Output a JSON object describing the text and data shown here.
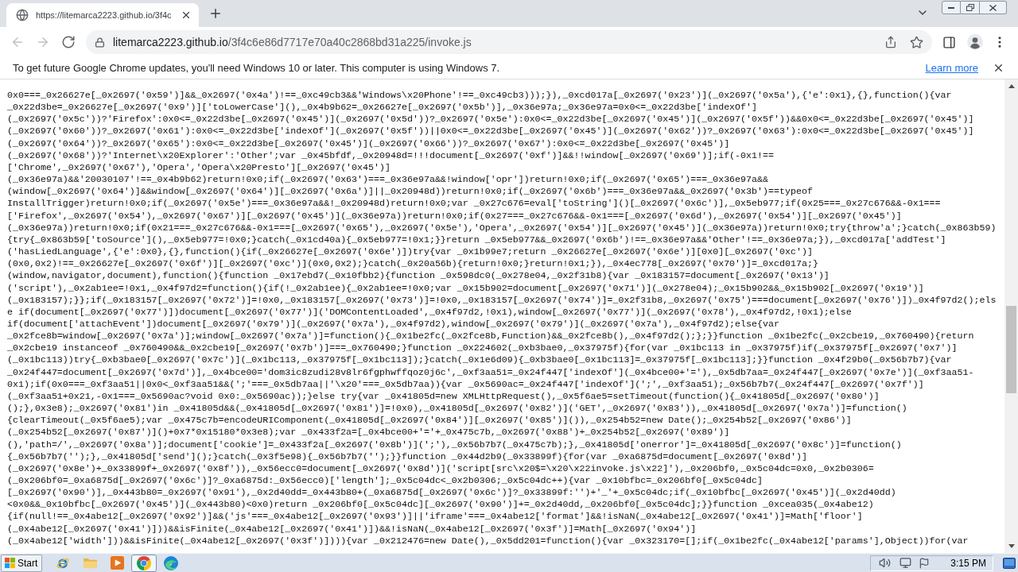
{
  "browser": {
    "tab": {
      "title": "https://litemarca2223.github.io/3f4c"
    },
    "nav_buttons": [
      {
        "kind": "back",
        "disabled": true
      },
      {
        "kind": "forward",
        "disabled": true
      },
      {
        "kind": "reload",
        "disabled": false
      }
    ],
    "address": {
      "domain": "litemarca2223.github.io",
      "path": "/3f4c6e86d7717e70a40c2868bd31a225/invoke.js"
    }
  },
  "infobar": {
    "message": "To get future Google Chrome updates, you'll need Windows 10 or later. This computer is using Windows 7.",
    "link": "Learn more"
  },
  "code_lines": [
    "0x0===_0x26627e[_0x2697('0x59')]&&_0x2697('0x4a')!==_0xc49cb3&&'Windows\\x20Phone'!==_0xc49cb3)));}),_0xcd017a[_0x2697('0x23')](_0x2697('0x5a'),{'e':0x1},{},function(){var",
    "_0x22d3be=_0x26627e[_0x2697('0x9')]['toLowerCase'](),_0x4b9b62=_0x26627e[_0x2697('0x5b')],_0x36e97a;_0x36e97a=0x0<=_0x22d3be['indexOf']",
    "(_0x2697('0x5c'))?'Firefox':0x0<=_0x22d3be[_0x2697('0x45')](_0x2697('0x5d'))?_0x2697('0x5e'):0x0<=_0x22d3be[_0x2697('0x45')](_0x2697('0x5f'))&&0x0<=_0x22d3be[_0x2697('0x45')]",
    "(_0x2697('0x60'))?_0x2697('0x61'):0x0<=_0x22d3be['indexOf'](_0x2697('0x5f'))||0x0<=_0x22d3be[_0x2697('0x45')](_0x2697('0x62'))?_0x2697('0x63'):0x0<=_0x22d3be[_0x2697('0x45')]",
    "(_0x2697('0x64'))?_0x2697('0x65'):0x0<=_0x22d3be[_0x2697('0x45')](_0x2697('0x66'))?_0x2697('0x67'):0x0<=_0x22d3be[_0x2697('0x45')]",
    "(_0x2697('0x68'))?'Internet\\x20Explorer':'Other';var _0x45bfdf,_0x20948d=!!!document[_0x2697('0xf')]&&!!window[_0x2697('0x69')];if(-0x1!==",
    "['Chrome',_0x2697('0x67'),'Opera','Opera\\x20Presto'][_0x2697('0x45')]",
    "(_0x36e97a)&&'20030107'!==_0x4b9b62)return!0x0;if(_0x2697('0x63')===_0x36e97a&&!window['opr'])return!0x0;if(_0x2697('0x65')===_0x36e97a&&",
    "(window[_0x2697('0x64')]&&window[_0x2697('0x64')][_0x2697('0x6a')]||_0x20948d))return!0x0;if(_0x2697('0x6b')===_0x36e97a&&_0x2697('0x3b')==typeof",
    "InstallTrigger)return!0x0;if(_0x2697('0x5e')===_0x36e97a&&!_0x20948d)return!0x0;var _0x27c676=eval['toString']()[_0x2697('0x6c')],_0x5eb977;if(0x25===_0x27c676&&-0x1===",
    "['Firefox',_0x2697('0x54'),_0x2697('0x67')][_0x2697('0x45')](_0x36e97a))return!0x0;if(0x27===_0x27c676&&-0x1===[_0x2697('0x6d'),_0x2697('0x54')][_0x2697('0x45')]",
    "(_0x36e97a))return!0x0;if(0x21===_0x27c676&&-0x1===[_0x2697('0x65'),_0x2697('0x5e'),'Opera',_0x2697('0x54')][_0x2697('0x45')](_0x36e97a))return!0x0;try{throw'a';}catch(_0x863b59)",
    "{try{_0x863b59['toSource'](),_0x5eb977=!0x0;}catch(_0x1cd40a){_0x5eb977=!0x1;}}return _0x5eb977&&_0x2697('0x6b')!==_0x36e97a&&'Other'!==_0x36e97a;}),_0xcd017a['addTest']",
    "('hasLiedLanguage',{'e':0x0},{},function(){if(_0x26627e[_0x2697('0x6e')])try{var _0x1b99e7;return _0x26627e[_0x2697('0x6e')][0x0][_0x2697('0xc')]",
    "(0x0,0x2)!==_0x26627e[_0x2697('0x6f')][_0x2697('0xc')](0x0,0x2);}catch(_0x20a56b){return!0x0;}return!0x1;}),_0x4ec778[_0x2697('0x70')]=_0xcd017a;}",
    "(window,navigator,document),function(){function _0x17ebd7(_0x10fbb2){function _0x598dc0(_0x278e04,_0x2f31b8){var _0x183157=document[_0x2697('0x13')]",
    "('script'),_0x2ab1ee=!0x1,_0x4f97d2=function(){if(!_0x2ab1ee){_0x2ab1ee=!0x0;var _0x15b902=document[_0x2697('0x71')](_0x278e04);_0x15b902&&_0x15b902[_0x2697('0x19')]",
    "(_0x183157);}};if(_0x183157[_0x2697('0x72')]=!0x0,_0x183157[_0x2697('0x73')]=!0x0,_0x183157[_0x2697('0x74')]=_0x2f31b8,_0x2697('0x75')===document[_0x2697('0x76')])_0x4f97d2();els",
    "e if(document[_0x2697('0x77')])document[_0x2697('0x77')]('DOMContentLoaded',_0x4f97d2,!0x1),window[_0x2697('0x77')](_0x2697('0x78'),_0x4f97d2,!0x1);else",
    "if(document['attachEvent'])document[_0x2697('0x79')](_0x2697('0x7a'),_0x4f97d2),window[_0x2697('0x79')](_0x2697('0x7a'),_0x4f97d2);else{var",
    "_0x2fce8b=window[_0x2697('0x7a')];window[_0x2697('0x7a')]=function(){_0x1be2fc(_0x2fce8b,Function)&&_0x2fce8b(),_0x4f97d2();};}}function _0x1be2fc(_0x2cbe19,_0x760490){return",
    "_0x2cbe19 instanceof _0x760490&&_0x2cbe19[_0x2697('0x7b')]===_0x760490;}function _0x224602(_0xb3bae0,_0x37975f){for(var _0x1bc113 in _0x37975f)if(_0x37975f[_0x2697('0x7')]",
    "(_0x1bc113))try{_0xb3bae0[_0x2697('0x7c')](_0x1bc113,_0x37975f[_0x1bc113]);}catch(_0x1e6d09){_0xb3bae0[_0x1bc113]=_0x37975f[_0x1bc113];}}function _0x4f29b0(_0x56b7b7){var",
    "_0x24f447=document[_0x2697('0x7d')],_0x4bce00='dom3ic8zudi28v8lr6fgphwffqoz0j6c',_0xf3aa51=_0x24f447['indexOf'](_0x4bce00+'='),_0x5db7aa=_0x24f447[_0x2697('0x7e')](_0xf3aa51-",
    "0x1);if(0x0===_0xf3aa51||0x0<_0xf3aa51&&(';'===_0x5db7aa||'\\x20'===_0x5db7aa)){var _0x5690ac=_0x24f447['indexOf'](';',_0xf3aa51);_0x56b7b7(_0x24f447[_0x2697('0x7f')]",
    "(_0xf3aa51+0x21,-0x1===_0x5690ac?void 0x0:_0x5690ac));}else try{var _0x41805d=new XMLHttpRequest(),_0x5f6ae5=setTimeout(function(){_0x41805d[_0x2697('0x80')]",
    "();},0x3e8);_0x2697('0x81')in _0x41805d&&(_0x41805d[_0x2697('0x81')]=!0x0),_0x41805d[_0x2697('0x82')]('GET',_0x2697('0x83')),_0x41805d[_0x2697('0x7a')]=function()",
    "{clearTimeout(_0x5f6ae5);var _0x475c7b=encodeURIComponent(_0x41805d[_0x2697('0x84')][_0x2697('0x85')]()),_0x254b52=new Date();_0x254b52[_0x2697('0x86')]",
    "(_0x254b52[_0x2697('0x87')]()+0x7*0x15180*0x3e8);var _0x433f2a=[_0x4bce00+'='+_0x475c7b,_0x2697('0x88')+_0x254b52[_0x2697('0x89')]",
    "(),'path=/',_0x2697('0x8a')];document['cookie']=_0x433f2a[_0x2697('0x8b')](';'),_0x56b7b7(_0x475c7b);},_0x41805d['onerror']=_0x41805d[_0x2697('0x8c')]=function()",
    "{_0x56b7b7('');},_0x41805d['send']();}catch(_0x3f5e98){_0x56b7b7('');}}function _0x44d2b9(_0x33899f){for(var _0xa6875d=document[_0x2697('0x8d')]",
    "(_0x2697('0x8e')+_0x33899f+_0x2697('0x8f')),_0x56ecc0=document[_0x2697('0x8d')]('script[src\\x20$=\\x20\\x22invoke.js\\x22]'),_0x206bf0,_0x5c04dc=0x0,_0x2b0306=",
    "(_0x206bf0=_0xa6875d[_0x2697('0x6c')]?_0xa6875d:_0x56ecc0)['length'];_0x5c04dc<_0x2b0306;_0x5c04dc++){var _0x10bfbc=_0x206bf0[_0x5c04dc]",
    "[_0x2697('0x90')],_0x443b80=_0x2697('0x91'),_0x2d40dd=_0x443b80+(_0xa6875d[_0x2697('0x6c')]?_0x33899f:'')+'_'+_0x5c04dc;if(_0x10bfbc[_0x2697('0x45')](_0x2d40dd)",
    "<0x0&&_0x10bfbc[_0x2697('0x45')](_0x443b80)<0x0)return _0x206bf0[_0x5c04dc][_0x2697('0x90')]+=_0x2d40dd,_0x206bf0[_0x5c04dc];}}function _0xcea035(_0x4abe12)",
    "{if(null!==_0x4abe12[_0x2697('0x92')]&&('js'===_0x4abe12[_0x2697('0x93')]||'iframe'===_0x4abe12['format']&&!isNaN(_0x4abe12[_0x2697('0x41')]=Math['floor']",
    "(_0x4abe12[_0x2697('0x41')]))&&isFinite(_0x4abe12[_0x2697('0x41')])&&!isNaN(_0x4abe12[_0x2697('0x3f')]=Math[_0x2697('0x94')]",
    "(_0x4abe12['width']))&&isFinite(_0x4abe12[_0x2697('0x3f')]))){var _0x212476=new Date(),_0x5dd201=function(){var _0x323170=[];if(_0x1be2fc(_0x4abe12['params'],Object))for(var"
  ],
  "taskbar": {
    "start": "Start",
    "apps": [
      {
        "kind": "ie",
        "selected": false
      },
      {
        "kind": "folder",
        "selected": false
      },
      {
        "kind": "media",
        "selected": false
      },
      {
        "kind": "chrome",
        "selected": true
      },
      {
        "kind": "edge",
        "selected": false
      }
    ],
    "clock": "3:15 PM"
  }
}
